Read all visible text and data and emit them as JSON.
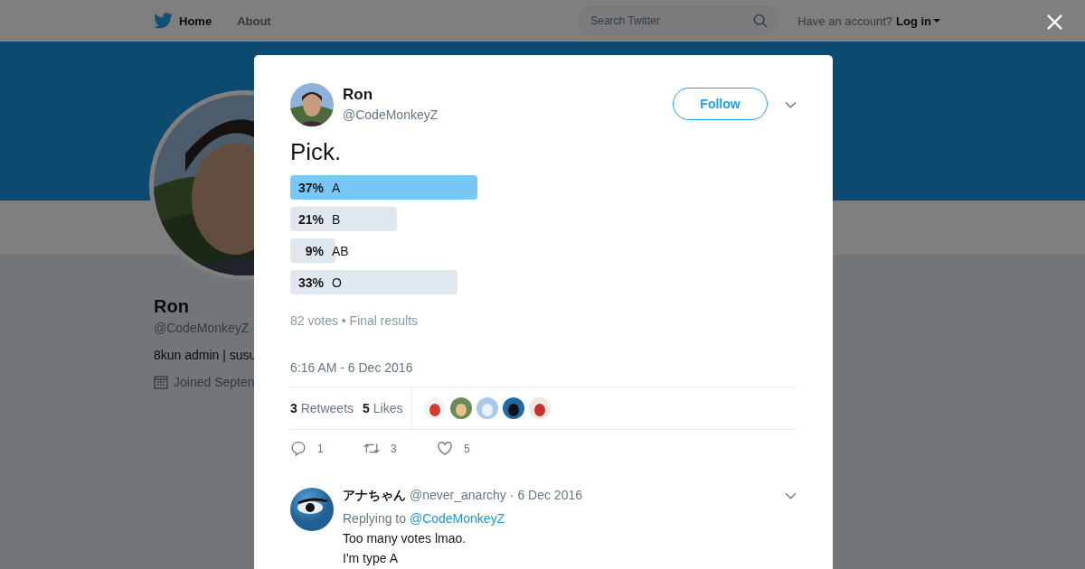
{
  "topbar": {
    "nav": [
      {
        "label": "Home",
        "selected": true
      },
      {
        "label": "About",
        "selected": false
      }
    ],
    "search": {
      "placeholder": "Search Twitter"
    },
    "account_prompt": "Have an account?",
    "login": "Log in"
  },
  "profile": {
    "name": "Ron",
    "handle": "@CodeMonkeyZ",
    "bio": "8kun admin | susu",
    "joined": "Joined Septen"
  },
  "tweet": {
    "name": "Ron",
    "handle": "@CodeMonkeyZ",
    "follow": "Follow",
    "text": "Pick.",
    "poll": {
      "options": [
        {
          "percent": "37%",
          "label": "A",
          "leading": true
        },
        {
          "percent": "21%",
          "label": "B",
          "leading": false
        },
        {
          "percent": "9%",
          "label": "AB",
          "leading": false
        },
        {
          "percent": "33%",
          "label": "O",
          "leading": false
        }
      ],
      "summary": "82 votes • Final results"
    },
    "timestamp": "6:16 AM - 6 Dec 2016",
    "stats": [
      {
        "count": "3",
        "label": "Retweets"
      },
      {
        "count": "5",
        "label": "Likes"
      }
    ],
    "actions": [
      {
        "kind": "reply",
        "count": "1"
      },
      {
        "kind": "retweet",
        "count": "3"
      },
      {
        "kind": "like",
        "count": "5"
      }
    ]
  },
  "reply": {
    "name": "アナちゃん",
    "handle": "@never_anarchy",
    "date": "· 6 Dec 2016",
    "replying_to": "Replying to",
    "mention": "@CodeMonkeyZ",
    "lines": [
      "Too many votes lmao.",
      "I'm type A"
    ]
  }
}
